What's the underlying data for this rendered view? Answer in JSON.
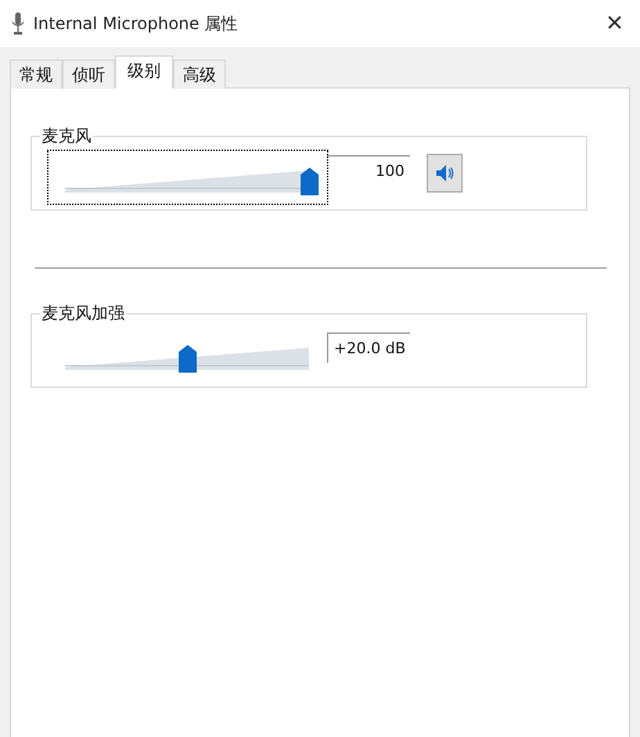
{
  "window": {
    "title": "Internal Microphone 属性",
    "close": "✕"
  },
  "tabs": [
    {
      "label": "常规",
      "selected": false
    },
    {
      "label": "侦听",
      "selected": false
    },
    {
      "label": "级别",
      "selected": true
    },
    {
      "label": "高级",
      "selected": false
    }
  ],
  "groups": [
    {
      "label": "麦克风",
      "level": 1.0,
      "reading": "100",
      "focused": true,
      "has_mute": true,
      "muted": false
    },
    {
      "label": "麦克风加强",
      "level": 0.5,
      "reading": "+20.0 dB",
      "focused": false,
      "has_mute": false
    }
  ]
}
